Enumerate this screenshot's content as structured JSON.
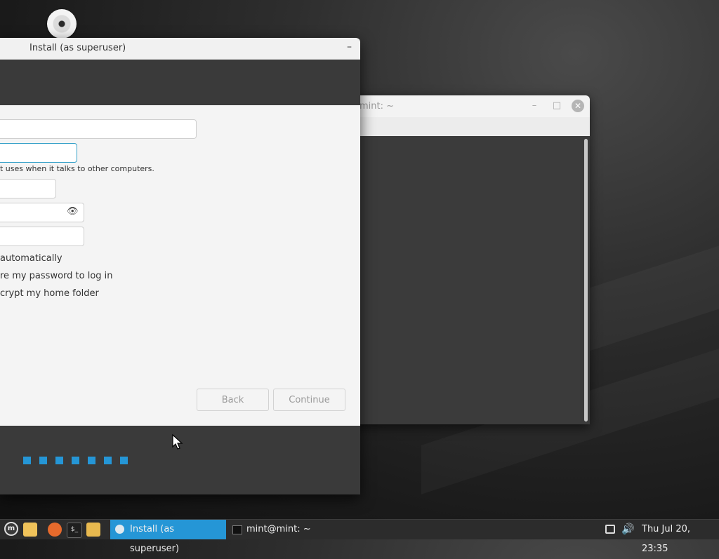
{
  "installer": {
    "title": "Install (as superuser)",
    "minimize": "–",
    "hint_text": "t uses when it talks to other computers.",
    "options": [
      "automatically",
      "re my password to log in",
      "crypt my home folder"
    ],
    "back_label": "Back",
    "continue_label": "Continue",
    "progress_dots": 7
  },
  "terminal": {
    "title": "mint: ~",
    "minimize": "–",
    "maximize": "□",
    "close": "✕"
  },
  "taskbar": {
    "menu_glyph": "m",
    "terminal_glyph": "$_",
    "tasks": [
      {
        "label": "Install (as superuser)"
      },
      {
        "label": "mint@mint: ~"
      }
    ],
    "volume_glyph": "🔊",
    "clock": "Thu Jul 20, 23:35"
  },
  "colors": {
    "accent": "#2596d6",
    "panel": "#2c2c2c"
  }
}
